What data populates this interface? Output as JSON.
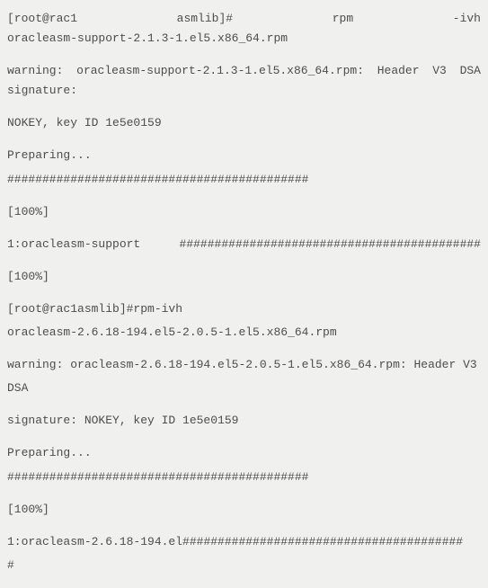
{
  "cmd1": {
    "prompt_user": "[root@rac1",
    "prompt_dir": "asmlib]#",
    "cmd": "rpm",
    "flag": "-ivh",
    "file": "oracleasm-support-2.1.3-1.el5.x86_64.rpm"
  },
  "warn1": {
    "label": "warning:",
    "file": "oracleasm-support-2.1.3-1.el5.x86_64.rpm:",
    "head": "Header",
    "ver": "V3",
    "alg": "DSA",
    "sig": "signature:"
  },
  "nokey1": "NOKEY, key ID 1e5e0159",
  "prep1": {
    "label": "Preparing...",
    "hashes": "###########################################"
  },
  "pct1": "[100%]",
  "pkg1": {
    "label": "1:oracleasm-support",
    "hashes": "###########################################"
  },
  "pct2": "[100%]",
  "cmd2": {
    "prompt": "[root@rac1asmlib]#rpm-ivh",
    "file": "oracleasm-2.6.18-194.el5-2.0.5-1.el5.x86_64.rpm"
  },
  "warn2": {
    "line1": "warning: oracleasm-2.6.18-194.el5-2.0.5-1.el5.x86_64.rpm: Header V3",
    "line2": "DSA"
  },
  "sig2": "signature: NOKEY, key ID 1e5e0159",
  "prep2": {
    "label": "Preparing...",
    "hashes": "###########################################"
  },
  "pct3": "[100%]",
  "pkg2": {
    "label": "1:oracleasm-2.6.18-194.el",
    "hashes": "########################################",
    "tail": "#"
  }
}
